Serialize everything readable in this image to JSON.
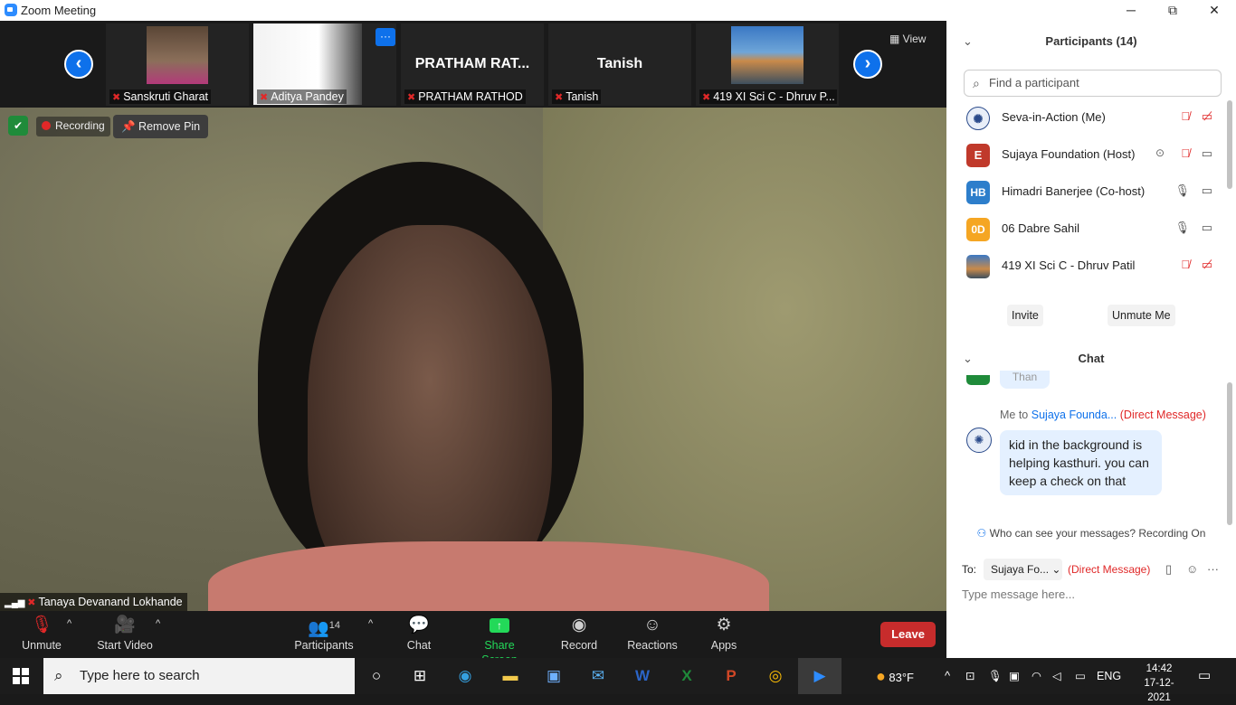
{
  "window": {
    "title": "Zoom Meeting",
    "minimize": "─",
    "restore": "⧉",
    "close": "✕"
  },
  "gallery": {
    "prev": "‹",
    "next": "›",
    "view_label": "View",
    "thumbs": [
      {
        "label": "Sanskruti Gharat",
        "big": ""
      },
      {
        "label": "Aditya Pandey",
        "big": ""
      },
      {
        "label": "PRATHAM RATHOD",
        "big": "PRATHAM RAT..."
      },
      {
        "label": "Tanish",
        "big": "Tanish"
      },
      {
        "label": "419 XI Sci C - Dhruv P...",
        "big": ""
      }
    ],
    "more": "···"
  },
  "main_video": {
    "recording_label": "Recording",
    "remove_pin_label": "Remove Pin",
    "speaker_name": "Tanaya Devanand Lokhande"
  },
  "toolbar": {
    "unmute": "Unmute",
    "start_video": "Start Video",
    "participants": "Participants",
    "participants_count": "14",
    "chat": "Chat",
    "share_screen": "Share Screen",
    "record": "Record",
    "reactions": "Reactions",
    "apps": "Apps",
    "leave": "Leave"
  },
  "participants_panel": {
    "title": "Participants (14)",
    "find_placeholder": "Find a participant",
    "list": [
      {
        "name": "Seva-in-Action (Me)",
        "initials": ""
      },
      {
        "name": "Sujaya Foundation (Host)",
        "initials": "E"
      },
      {
        "name": "Himadri Banerjee (Co-host)",
        "initials": "HB"
      },
      {
        "name": "06 Dabre Sahil",
        "initials": "0D"
      },
      {
        "name": "419 XI Sci C - Dhruv Patil",
        "initials": ""
      }
    ],
    "invite": "Invite",
    "unmute_me": "Unmute Me"
  },
  "chat_panel": {
    "title": "Chat",
    "prev_fragment": "Than",
    "msg_from": "Me to",
    "msg_to": "Sujaya Founda...",
    "msg_dm": "(Direct Message)",
    "msg_text": "kid in the background is helping kasthuri. you can keep a check on that",
    "who_can_see": "Who can see your messages? Recording On",
    "to_label": "To:",
    "to_recipient": "Sujaya Fo...",
    "to_dm": "(Direct Message)",
    "input_placeholder": "Type message here..."
  },
  "taskbar": {
    "search_placeholder": "Type here to search",
    "weather": "83°F",
    "lang": "ENG",
    "time": "14:42",
    "date": "17-12-2021"
  },
  "colors": {
    "accent": "#0e71eb",
    "danger": "#e02828",
    "share_green": "#23d959",
    "leave_red": "#c72c2c"
  }
}
